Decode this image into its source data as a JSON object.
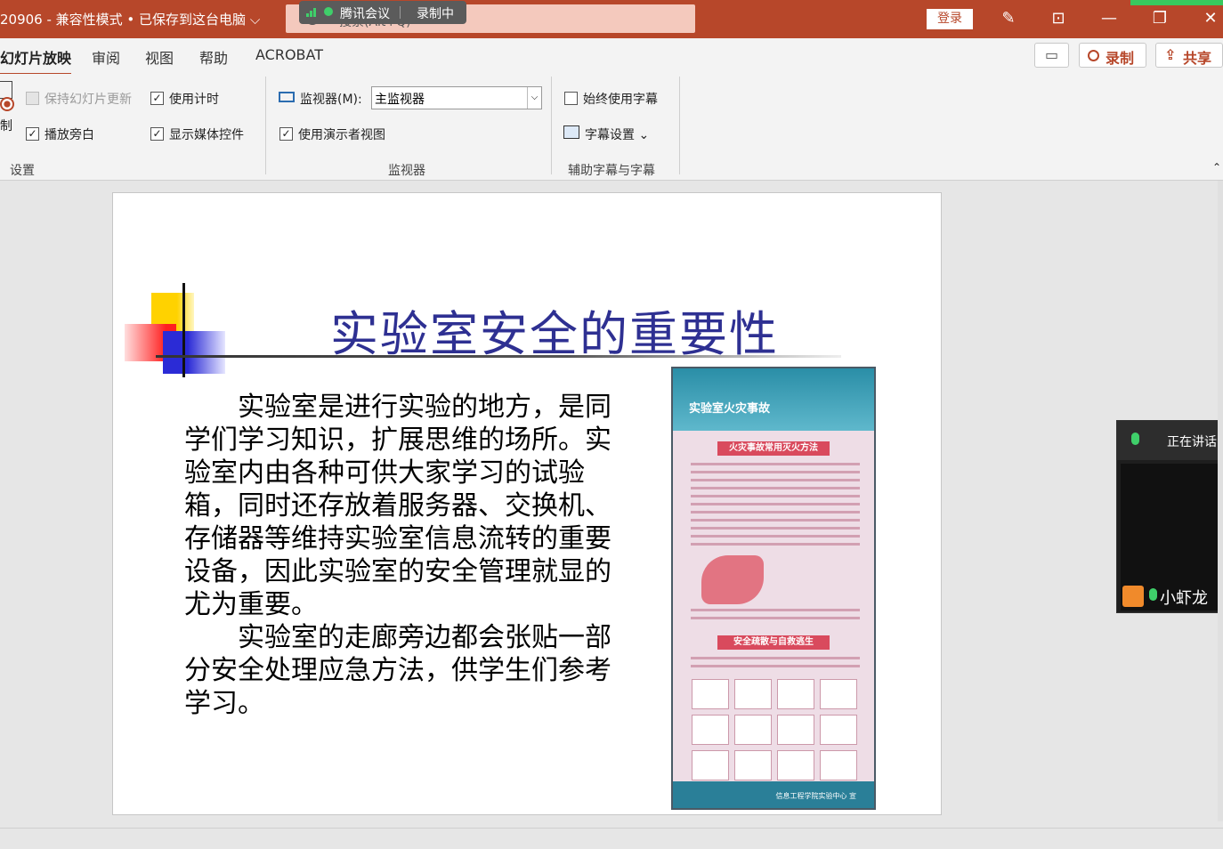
{
  "titlebar": {
    "doc_title": "20906  -  兼容性模式 • 已保存到这台电脑 ⌵",
    "search_placeholder": "搜索(Alt+Q)",
    "meeting_app": "腾讯会议",
    "recording": "录制中",
    "login": "登录"
  },
  "tabs": [
    "幻灯片放映",
    "审阅",
    "视图",
    "帮助",
    "ACROBAT"
  ],
  "right_buttons": {
    "record": "录制",
    "share": "共享"
  },
  "ribbon": {
    "record_label": "制",
    "keep_updated": "保持幻灯片更新",
    "use_timing": "使用计时",
    "play_narration": "播放旁白",
    "show_media": "显示媒体控件",
    "group_setup": "设置",
    "monitor_label": "监视器(M):",
    "monitor_value": "主监视器",
    "presenter_view": "使用演示者视图",
    "group_monitor": "监视器",
    "always_subtitles": "始终使用字幕",
    "subtitle_settings": "字幕设置 ⌄",
    "group_subtitles": "辅助字幕与字幕"
  },
  "slide": {
    "title": "实验室安全的重要性",
    "paragraphs": [
      "实验室是进行实验的地方，是同学们学习知识，扩展思维的场所。实验室内由各种可供大家学习的试验箱，同时还存放着服务器、交换机、存储器等维持实验室信息流转的重要设备，因此实验室的安全管理就显的尤为重要。",
      "实验室的走廊旁边都会张贴一部分安全处理应急方法，供学生们参考学习。"
    ],
    "poster": {
      "title": "实验室火灾事故",
      "section1": "火灾事故常用灭火方法",
      "section2": "安全疏散与自救逃生",
      "footer": "信息工程学院实验中心 宣"
    }
  },
  "meeting": {
    "speaking": "正在讲话:",
    "participant": "小虾龙"
  },
  "colors": {
    "accent": "#b7472a",
    "title_blue": "#2e3092"
  }
}
